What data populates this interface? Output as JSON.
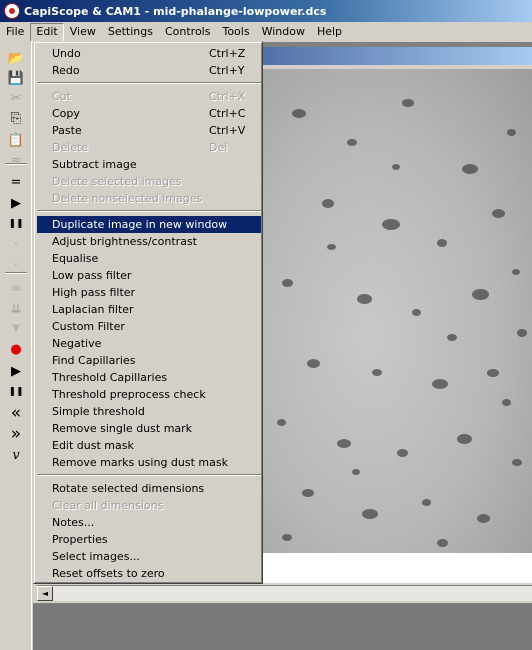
{
  "window": {
    "title": "CapiScope & CAM1 - mid-phalange-lowpower.dcs",
    "app_icon": "capiscope-app-icon"
  },
  "menubar": [
    {
      "label": "File",
      "name": "menu-file"
    },
    {
      "label": "Edit",
      "name": "menu-edit",
      "open": true
    },
    {
      "label": "View",
      "name": "menu-view"
    },
    {
      "label": "Settings",
      "name": "menu-settings"
    },
    {
      "label": "Controls",
      "name": "menu-controls"
    },
    {
      "label": "Tools",
      "name": "menu-tools"
    },
    {
      "label": "Window",
      "name": "menu-window"
    },
    {
      "label": "Help",
      "name": "menu-help"
    }
  ],
  "toolbar": {
    "icons": [
      {
        "name": "open-folder-icon",
        "glyph": "📂",
        "enabled": true
      },
      {
        "name": "save-icon",
        "glyph": "💾",
        "enabled": true
      },
      {
        "name": "cut-icon",
        "glyph": "✂",
        "enabled": false
      },
      {
        "name": "copy-icon",
        "glyph": "⎘",
        "enabled": true
      },
      {
        "name": "paste-icon",
        "glyph": "📋",
        "enabled": true
      },
      {
        "name": "waveform-icon",
        "glyph": "≈",
        "enabled": false
      },
      {
        "name": "equals-icon",
        "glyph": "=",
        "enabled": true
      },
      {
        "name": "play-icon",
        "glyph": "▶",
        "enabled": true
      },
      {
        "name": "pause-icon",
        "glyph": "❚❚",
        "enabled": true
      },
      {
        "name": "small-dot-icon",
        "glyph": "·",
        "enabled": false
      },
      {
        "name": "small-dot-2-icon",
        "glyph": "·",
        "enabled": false
      },
      {
        "name": "binoculars-icon",
        "glyph": "∞",
        "enabled": false
      },
      {
        "name": "down-arrows-icon",
        "glyph": "⇊",
        "enabled": false
      },
      {
        "name": "trace-icon",
        "glyph": "⩔",
        "enabled": false
      },
      {
        "name": "record-icon",
        "glyph": "●",
        "enabled": true,
        "color": "#e00000"
      },
      {
        "name": "play-2-icon",
        "glyph": "▶",
        "enabled": true
      },
      {
        "name": "pause-2-icon",
        "glyph": "❚❚",
        "enabled": true
      },
      {
        "name": "rewind-icon",
        "glyph": "«",
        "enabled": true
      },
      {
        "name": "fast-forward-icon",
        "glyph": "»",
        "enabled": true
      },
      {
        "name": "velocity-icon",
        "glyph": "v",
        "enabled": true
      }
    ]
  },
  "edit_menu": {
    "items": [
      {
        "label": "Undo",
        "shortcut": "Ctrl+Z",
        "enabled": true
      },
      {
        "label": "Redo",
        "shortcut": "Ctrl+Y",
        "enabled": true
      },
      {
        "separator": true
      },
      {
        "label": "Cut",
        "shortcut": "Ctrl+X",
        "enabled": false
      },
      {
        "label": "Copy",
        "shortcut": "Ctrl+C",
        "enabled": true
      },
      {
        "label": "Paste",
        "shortcut": "Ctrl+V",
        "enabled": true
      },
      {
        "label": "Delete",
        "shortcut": "Del",
        "enabled": false
      },
      {
        "label": "Subtract image",
        "enabled": true
      },
      {
        "label": "Delete selected images",
        "enabled": false
      },
      {
        "label": "Delete nonselected images",
        "enabled": false
      },
      {
        "separator": true
      },
      {
        "label": "Duplicate image in new window",
        "enabled": true,
        "highlighted": true
      },
      {
        "label": "Adjust brightness/contrast",
        "enabled": true
      },
      {
        "label": "Equalise",
        "enabled": true
      },
      {
        "label": "Low pass filter",
        "enabled": true
      },
      {
        "label": "High pass filter",
        "enabled": true
      },
      {
        "label": "Laplacian filter",
        "enabled": true
      },
      {
        "label": "Custom Filter",
        "enabled": true
      },
      {
        "label": "Negative",
        "enabled": true
      },
      {
        "label": "Find Capillaries",
        "enabled": true
      },
      {
        "label": "Threshold Capillaries",
        "enabled": true
      },
      {
        "label": "Threshold preprocess check",
        "enabled": true
      },
      {
        "label": "Simple threshold",
        "enabled": true
      },
      {
        "label": "Remove single dust mark",
        "enabled": true
      },
      {
        "label": "Edit dust mask",
        "enabled": true
      },
      {
        "label": "Remove marks using dust mask",
        "enabled": true
      },
      {
        "separator": true
      },
      {
        "label": "Rotate selected dimensions",
        "enabled": true
      },
      {
        "label": "Clear all dimensions",
        "enabled": false
      },
      {
        "label": "Notes...",
        "enabled": true
      },
      {
        "label": "Properties",
        "enabled": true
      },
      {
        "label": "Select images...",
        "enabled": true
      },
      {
        "label": "Reset offsets to zero",
        "enabled": true
      }
    ]
  },
  "image_view": {
    "description_name": "capillary-microscope-image"
  },
  "scrollbar": {
    "left_arrow": "◄"
  }
}
